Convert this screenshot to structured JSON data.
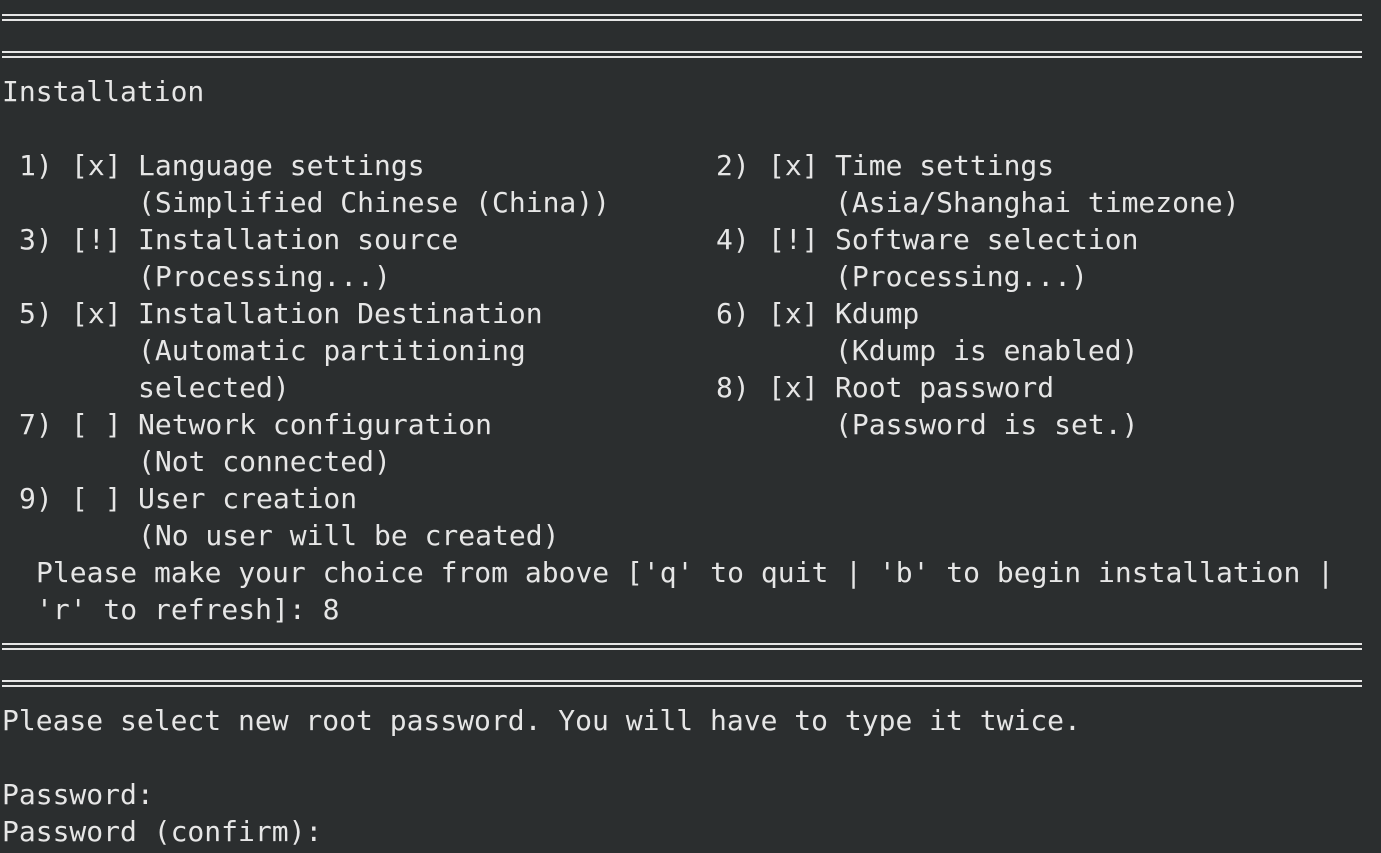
{
  "installation": {
    "title": "Installation",
    "options": [
      {
        "num": "1)",
        "status": "[x]",
        "label": "Language settings",
        "detail": "(Simplified Chinese (China))"
      },
      {
        "num": "2)",
        "status": "[x]",
        "label": "Time settings",
        "detail": "(Asia/Shanghai timezone)"
      },
      {
        "num": "3)",
        "status": "[!]",
        "label": "Installation source",
        "detail": "(Processing...)"
      },
      {
        "num": "4)",
        "status": "[!]",
        "label": "Software selection",
        "detail": "(Processing...)"
      },
      {
        "num": "5)",
        "status": "[x]",
        "label": "Installation Destination",
        "detail": "(Automatic partitioning",
        "detail2": "selected)"
      },
      {
        "num": "6)",
        "status": "[x]",
        "label": "Kdump",
        "detail": "(Kdump is enabled)"
      },
      {
        "num": "7)",
        "status": "[ ]",
        "label": "Network configuration",
        "detail": "(Not connected)"
      },
      {
        "num": "8)",
        "status": "[x]",
        "label": "Root password",
        "detail": "(Password is set.)"
      },
      {
        "num": "9)",
        "status": "[ ]",
        "label": "User creation",
        "detail": "(No user will be created)"
      }
    ],
    "prompt_line1": "Please make your choice from above ['q' to quit | 'b' to begin installation |",
    "prompt_line2": "'r' to refresh]: 8"
  },
  "root_password": {
    "instruction": "Please select new root password. You will have to type it twice.",
    "password_label": "Password:",
    "confirm_label": "Password (confirm):"
  }
}
